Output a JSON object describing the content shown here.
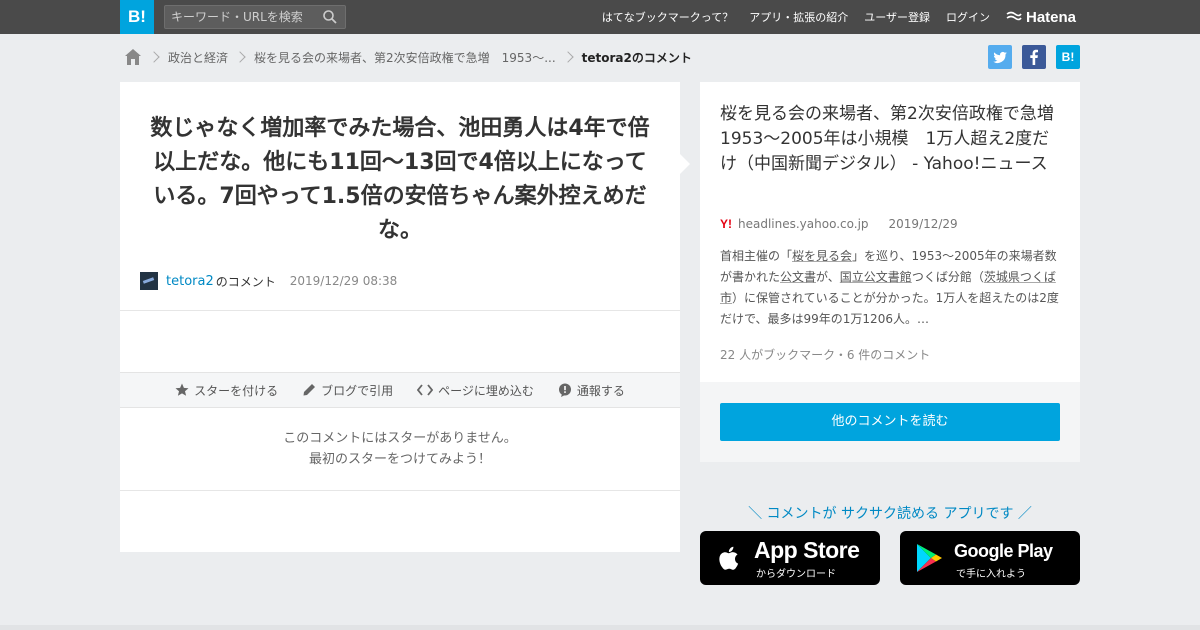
{
  "header": {
    "logo": "B!",
    "search_placeholder": "キーワード・URLを検索",
    "nav": [
      "はてなブックマークって？",
      "アプリ・拡張の紹介",
      "ユーザー登録",
      "ログイン"
    ],
    "brand": "Hatena"
  },
  "breadcrumb": {
    "items": [
      "政治と経済",
      "桜を見る会の来場者、第2次安倍政権で急増　1953～...",
      "tetora2のコメント"
    ]
  },
  "share": {
    "twitter": "t",
    "facebook": "f",
    "hatena": "B!"
  },
  "comment": {
    "text": "数じゃなく増加率でみた場合、池田勇人は4年で倍以上だな。他にも11回～13回で4倍以上になっている。7回やって1.5倍の安倍ちゃん案外控えめだな。",
    "user": "tetora2",
    "user_suffix": "のコメント",
    "date": "2019/12/29 08:38"
  },
  "actions": {
    "star": "スターを付ける",
    "blog": "ブログで引用",
    "embed": "ページに埋め込む",
    "report": "通報する"
  },
  "stars": {
    "line1": "このコメントにはスターがありません。",
    "line2": "最初のスターをつけてみよう！"
  },
  "entry": {
    "title": "桜を見る会の来場者、第2次安倍政権で急増　1953～2005年は小規模　1万人超え2度だけ（中国新聞デジタル） - Yahoo!ニュース",
    "source_icon": "Y!",
    "domain": "headlines.yahoo.co.jp",
    "date": "2019/12/29",
    "summary": {
      "p1": "首相主催の「",
      "u1": "桜を見る会",
      "p2": "」を巡り、1953～2005年の来場者数が書かれた",
      "u2": "公文書",
      "p3": "が、",
      "u3": "国立公文書館",
      "p4": "つくば分館（",
      "u4": "茨城県つくば市",
      "p5": "）に保管されていることが分かった。1万人を超えたのは2度だけで、最多は99年の1万1206人。…"
    },
    "stats": "22 人がブックマーク・6 件のコメント",
    "read_more": "他のコメントを読む"
  },
  "promo": {
    "tagline": "＼ コメントが サクサク読める アプリです ／",
    "apple_big": "App Store",
    "apple_small": "からダウンロード",
    "google_big": "Google Play",
    "google_small": "で手に入れよう"
  },
  "colors": {
    "accent": "#00a4de",
    "link": "#0089c4",
    "topbar": "#4a4a4a"
  }
}
